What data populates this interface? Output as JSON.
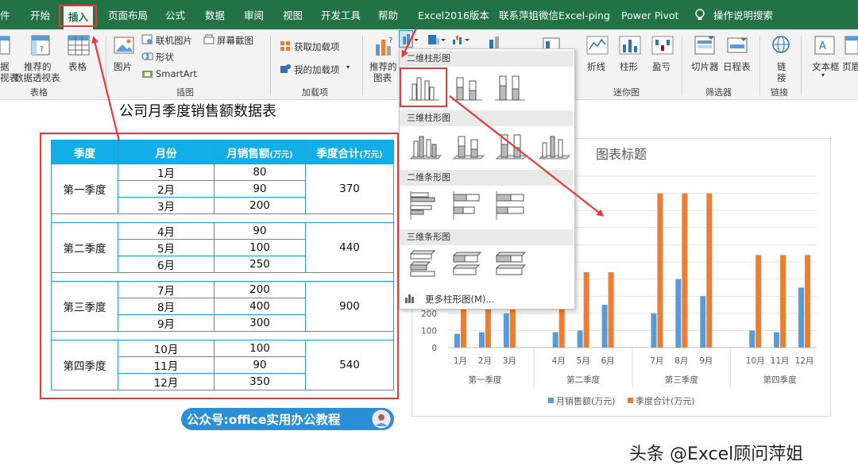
{
  "tabs": [
    "件",
    "开始",
    "插入",
    "页面布局",
    "公式",
    "数据",
    "审阅",
    "视图",
    "开发工具",
    "帮助",
    "Excel2016版本",
    "联系萍姐微信Excel-ping",
    "Power Pivot"
  ],
  "tell_me": "操作说明搜索",
  "ribbon": {
    "pivot_partial_1": "据",
    "pivot_partial_2": "视表",
    "recommended_pivot_1": "推荐的",
    "recommended_pivot_2": "数据透视表",
    "table": "表格",
    "picture": "图片",
    "online_picture": "联机图片",
    "shapes": "形状",
    "smartart": "SmartArt",
    "screenshot": "屏幕截图",
    "get_addins": "获取加载项",
    "my_addins": "我的加载项",
    "recommended_charts_1": "推荐的",
    "recommended_charts_2": "图表",
    "spark_line": "折线",
    "spark_column": "柱形",
    "spark_winloss": "盈亏",
    "slicer": "切片器",
    "timeline": "日程表",
    "link_1": "链",
    "link_2": "接",
    "textbox": "文本框",
    "header_partial": "页眉",
    "groups": {
      "tables": "表格",
      "illustrations": "插图",
      "addins": "加载项",
      "sparklines": "迷你图",
      "filters": "筛选器",
      "links": "链接"
    }
  },
  "dropdown": {
    "sections": [
      "二维柱形图",
      "三维柱形图",
      "二维条形图",
      "三维条形图"
    ],
    "more": "更多柱形图(M)..."
  },
  "table_title": "公司月季度销售额数据表",
  "table": {
    "headers": {
      "quarter": "季度",
      "month": "月份",
      "sales": "月销售额",
      "sales_unit": "(万元)",
      "total": "季度合计",
      "total_unit": "(万元)"
    },
    "groups": [
      {
        "quarter": "第一季度",
        "total": "370",
        "rows": [
          {
            "month": "1月",
            "sales": "80"
          },
          {
            "month": "2月",
            "sales": "90"
          },
          {
            "month": "3月",
            "sales": "200"
          }
        ]
      },
      {
        "quarter": "第二季度",
        "total": "440",
        "rows": [
          {
            "month": "4月",
            "sales": "90"
          },
          {
            "month": "5月",
            "sales": "100"
          },
          {
            "month": "6月",
            "sales": "250"
          }
        ]
      },
      {
        "quarter": "第三季度",
        "total": "900",
        "rows": [
          {
            "month": "7月",
            "sales": "200"
          },
          {
            "month": "8月",
            "sales": "400"
          },
          {
            "month": "9月",
            "sales": "300"
          }
        ]
      },
      {
        "quarter": "第四季度",
        "total": "540",
        "rows": [
          {
            "month": "10月",
            "sales": "100"
          },
          {
            "month": "11月",
            "sales": "90"
          },
          {
            "month": "12月",
            "sales": "350"
          }
        ]
      }
    ]
  },
  "watermark_badge": "公众号:office实用办公教程",
  "footer_watermark": "头条 @Excel顾问萍姐",
  "colors": {
    "excel_green": "#217346",
    "table_header": "#12aee8",
    "highlight": "#e8393b",
    "series_sales": "#5b9bd5",
    "series_total": "#ed7d31"
  },
  "chart_data": {
    "type": "bar",
    "title": "图表标题",
    "categories": [
      "1月",
      "2月",
      "3月",
      "4月",
      "5月",
      "6月",
      "7月",
      "8月",
      "9月",
      "10月",
      "11月",
      "12月"
    ],
    "groups": [
      "第一季度",
      "第二季度",
      "第三季度",
      "第四季度"
    ],
    "series": [
      {
        "name": "月销售额(万元)",
        "values": [
          80,
          90,
          200,
          90,
          100,
          250,
          200,
          400,
          300,
          100,
          90,
          350
        ]
      },
      {
        "name": "季度合计(万元)",
        "values": [
          370,
          370,
          370,
          440,
          440,
          440,
          900,
          900,
          900,
          540,
          540,
          540
        ]
      }
    ],
    "y_ticks": [
      "0",
      "100",
      "200"
    ],
    "ylim": [
      0,
      1000
    ],
    "grid": true,
    "legend": "bottom"
  }
}
